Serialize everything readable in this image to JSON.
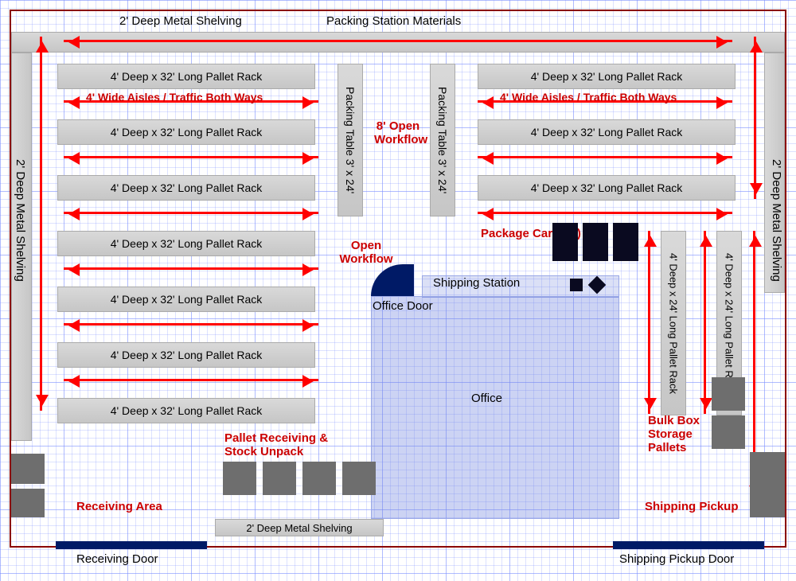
{
  "labels": {
    "top_left_shelf": "2' Deep Metal Shelving",
    "top_right": "Packing Station Materials",
    "left_shelf": "2' Deep Metal Shelving",
    "right_shelf": "2' Deep Metal Shelving",
    "rackL": "4' Deep x 32' Long Pallet Rack",
    "rackR": "4' Deep x 32' Long Pallet Rack",
    "aisles": "4' Wide Aisles / Traffic Both Ways",
    "packing_table": "Packing Table 3' x 24'",
    "open_flow_8": "8' Open Workflow",
    "open_flow": "Open Workflow",
    "shipping_station": "Shipping Station",
    "package_carts": "Package Carts (3)",
    "office": "Office",
    "office_door": "Office Door",
    "vrack24": "4' Deep x 24' Long Pallet Rack",
    "bulk_box": "Bulk Box Storage Pallets",
    "pallet_recv": "Pallet Receiving & Stock Unpack",
    "receiving_area": "Receiving Area",
    "bottom_shelf": "2' Deep Metal Shelving",
    "shipping_pickup": "Shipping Pickup",
    "receiving_door": "Receiving Door",
    "shipping_door": "Shipping Pickup Door"
  },
  "layout": {
    "left_racks_count": 7,
    "right_racks_count": 3,
    "package_carts_count": 3,
    "vertical_racks_right_count": 2,
    "bulk_box_pallets_count": 2,
    "receiving_pallets_count": 4
  }
}
